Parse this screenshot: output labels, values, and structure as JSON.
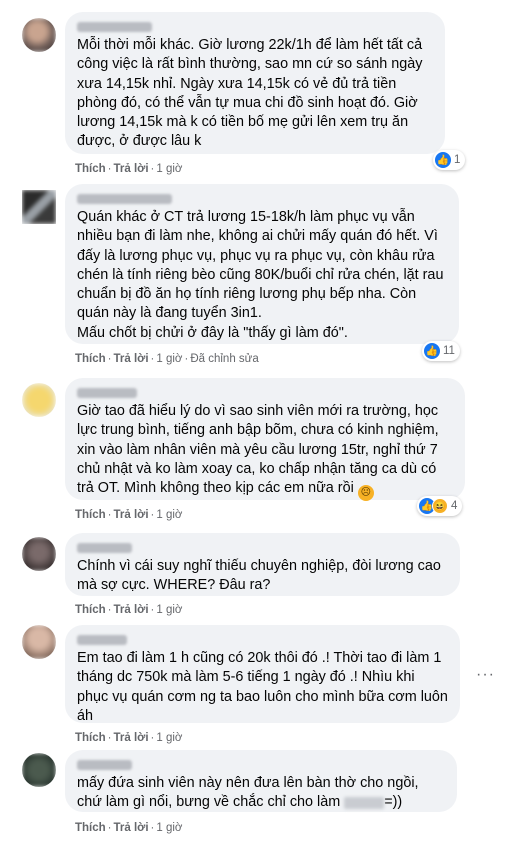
{
  "actions": {
    "like": "Thích",
    "reply": "Trả lời",
    "edited": "Đã chỉnh sửa"
  },
  "comments": [
    {
      "text": "Mỗi thời mỗi khác. Giờ lương 22k/1h để làm hết tất cả công việc là rất bình thường, sao mn cứ so sánh ngày xưa 14,15k nhỉ. Ngày xưa 14,15k có vẻ đủ trả tiền phòng đó, có thể vẫn tự mua chi đồ sinh hoạt đó. Giờ lương 14,15k mà k có tiền bố mẹ gửi lên xem trụ ăn được, ở được lâu k",
      "time": "1 giờ",
      "reaction_count": "1"
    },
    {
      "text": "Quán khác ở CT trả lương 15-18k/h làm phục vụ vẫn nhiều bạn đi làm nhe, không ai chửi mấy quán đó hết. Vì đấy là lương phục vụ, phục vụ ra phục vụ, còn khâu rửa chén là tính riêng bèo cũng 80K/buổi chỉ rửa chén, lặt rau chuẩn bị đồ ăn họ tính riêng lương phụ bếp nha. Còn quán này là đang tuyển 3in1.\nMấu chốt bị chửi ở đây là \"thấy gì làm đó\".",
      "time": "1 giờ",
      "reaction_count": "11"
    },
    {
      "text": "Giờ tao đã hiểu lý do vì sao sinh viên mới ra trường, học lực trung bình, tiếng anh bập bõm, chưa có kinh nghiệm, xin vào làm nhân viên mà yêu cầu lương 15tr, nghỉ thứ 7 chủ nhật và ko làm xoay ca, ko chấp nhận tăng ca dù có trả OT. Mình không theo kịp các em nữa rồi",
      "time": "1 giờ",
      "reaction_count": "4"
    },
    {
      "text": "Chính vì cái suy nghĩ thiếu chuyên nghiệp, đòi lương cao mà sợ cực. WHERE? Đâu ra?",
      "time": "1 giờ"
    },
    {
      "text": "Em tao đi làm 1 h cũng có 20k thôi đó .! Thời tao đi làm 1 tháng dc 750k mà làm 5-6 tiếng 1 ngày đó .! Nhìu khi phục vụ quán cơm ng ta bao luôn cho mình bữa cơm luôn áh",
      "time": "1 giờ"
    },
    {
      "text_before": "mấy đứa sinh viên này nên đưa lên bàn thờ cho ngồi, chứ làm gì nổi, bưng về chắc chỉ cho làm",
      "text_after": "=))",
      "time": "1 giờ"
    }
  ],
  "colors": {
    "bubble": "#f0f2f5",
    "like_blue": "#1877f2",
    "meta_gray": "#65676b"
  },
  "icons": {
    "like": "like-icon",
    "haha": "haha-icon",
    "sad": "sad-emoji-icon"
  }
}
